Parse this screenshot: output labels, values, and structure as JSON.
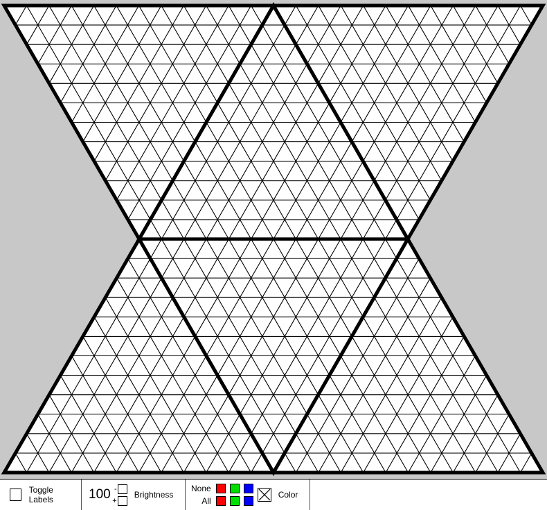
{
  "toolbar": {
    "toggle_labels": {
      "label": "Toggle Labels",
      "checked": false
    },
    "brightness": {
      "value": "100",
      "decrement_symbol": "-",
      "increment_symbol": "+",
      "label": "Brightness"
    },
    "color": {
      "none_label": "None",
      "all_label": "All",
      "swatches": {
        "none": [
          {
            "name": "red",
            "hex": "#ff0000"
          },
          {
            "name": "green",
            "hex": "#00dd00"
          },
          {
            "name": "blue",
            "hex": "#0000ff"
          }
        ],
        "all": [
          {
            "name": "red",
            "hex": "#ff0000"
          },
          {
            "name": "green",
            "hex": "#00dd00"
          },
          {
            "name": "blue",
            "hex": "#0000ff"
          }
        ]
      },
      "toggle_icon": "crossed-box-icon",
      "label": "Color",
      "toggle_checked": true
    }
  },
  "board": {
    "background": "#c8c8c8",
    "face_fill": "#ffffff",
    "line_color": "#000000",
    "subdivisions_per_edge": 12,
    "face_count": 6
  }
}
